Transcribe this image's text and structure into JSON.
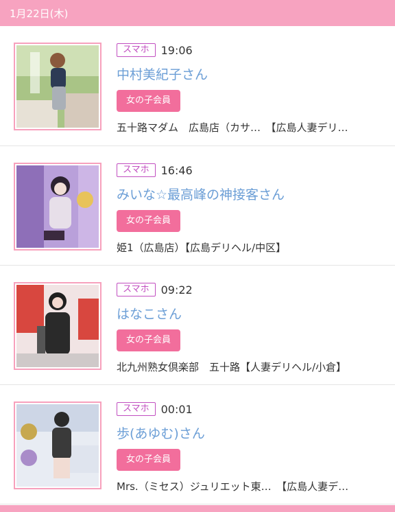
{
  "date": "1月22日(木)",
  "items": [
    {
      "badge": "スマホ",
      "time": "19:06",
      "name": "中村美紀子さん",
      "member": "女の子会員",
      "shop": "五十路マダム　広島店（カサ…　【広島人妻デリ…",
      "photo_colors": [
        "#9fbf7a",
        "#d8cfc4",
        "#2d3b55"
      ]
    },
    {
      "badge": "スマホ",
      "time": "16:46",
      "name": "みいな☆最高峰の神接客さん",
      "member": "女の子会員",
      "shop": "姫1（広島店）【広島デリヘル/中区】",
      "photo_colors": [
        "#b59ad6",
        "#e7d6ea",
        "#3b2a3f"
      ]
    },
    {
      "badge": "スマホ",
      "time": "09:22",
      "name": "はなこさん",
      "member": "女の子会員",
      "shop": "北九州熟女倶楽部　五十路【人妻デリヘル/小倉】",
      "photo_colors": [
        "#d8473f",
        "#f3e6e6",
        "#1f1f1f"
      ]
    },
    {
      "badge": "スマホ",
      "time": "00:01",
      "name": "歩(あゆむ)さん",
      "member": "女の子会員",
      "shop": "Mrs.（ミセス）ジュリエット東…　【広島人妻デ…",
      "photo_colors": [
        "#cdd6e6",
        "#eef0f5",
        "#2a2a2a"
      ]
    }
  ],
  "colors": {
    "date_bar": "#f7a3c0",
    "badge_border": "#c14ec0",
    "name_link": "#6b9ed6",
    "member_bg": "#f26e9c",
    "thumb_border": "#f7a0bc"
  }
}
